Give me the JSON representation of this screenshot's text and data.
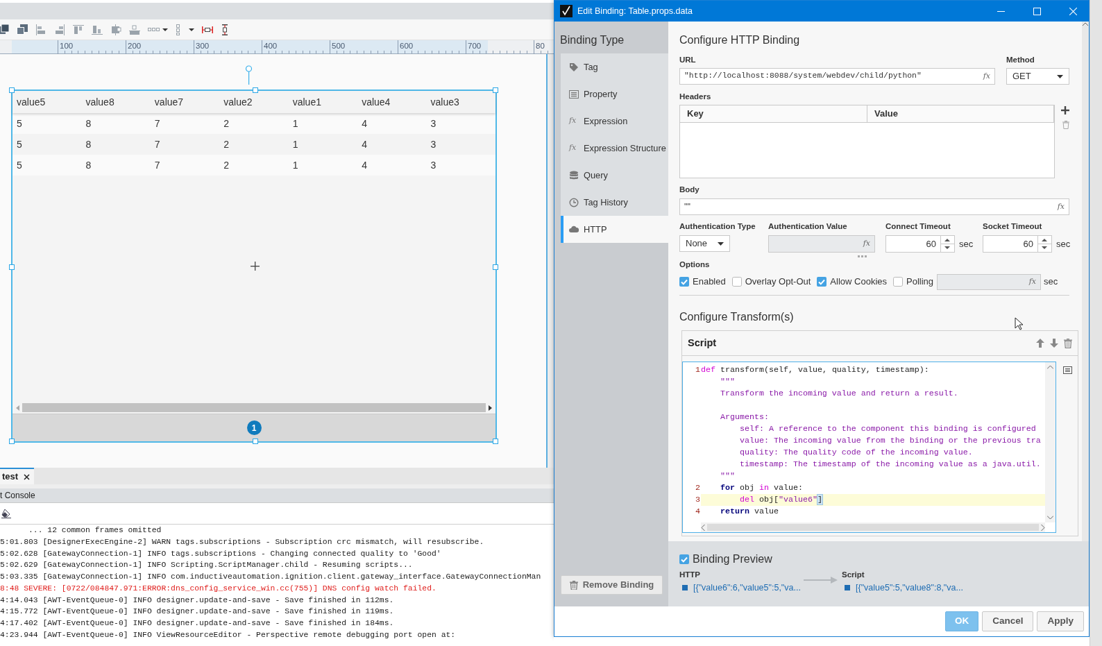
{
  "designer": {
    "ruler_labels": [
      "100",
      "200",
      "300",
      "400",
      "500",
      "600",
      "700",
      "80"
    ],
    "table": {
      "columns": [
        "value5",
        "value8",
        "value7",
        "value2",
        "value1",
        "value4",
        "value3"
      ],
      "rows": [
        [
          "5",
          "8",
          "7",
          "2",
          "1",
          "4",
          "3"
        ],
        [
          "5",
          "8",
          "7",
          "2",
          "1",
          "4",
          "3"
        ],
        [
          "5",
          "8",
          "7",
          "2",
          "1",
          "4",
          "3"
        ]
      ],
      "page": "1"
    },
    "tabs": [
      {
        "label": "test",
        "selected": true
      }
    ],
    "console": {
      "title": "t Console",
      "lines": [
        {
          "kind": "info",
          "text": "      ... 12 common frames omitted"
        },
        {
          "kind": "info",
          "text": "5:01.803 [DesignerExecEngine-2] WARN tags.subscriptions - Subscription crc mismatch, will resubscribe."
        },
        {
          "kind": "info",
          "text": "5:02.628 [GatewayConnection-1] INFO tags.subscriptions - Changing connected quality to 'Good'"
        },
        {
          "kind": "info",
          "text": "5:02.629 [GatewayConnection-1] INFO Scripting.ScriptManager.child - Resuming scripts..."
        },
        {
          "kind": "info",
          "text": "5:03.335 [GatewayConnection-1] INFO com.inductiveautomation.ignition.client.gateway_interface.GatewayConnectionMan"
        },
        {
          "kind": "severe",
          "text": "8:48 SEVERE: [0722/084847.971:ERROR:dns_config_service_win.cc(755)] DNS config watch failed."
        },
        {
          "kind": "info",
          "text": "4:14.043 [AWT-EventQueue-0] INFO designer.update-and-save - Save finished in 112ms."
        },
        {
          "kind": "info",
          "text": "4:15.772 [AWT-EventQueue-0] INFO designer.update-and-save - Save finished in 119ms."
        },
        {
          "kind": "info",
          "text": "4:17.402 [AWT-EventQueue-0] INFO designer.update-and-save - Save finished in 184ms."
        },
        {
          "kind": "info",
          "text": "4:23.944 [AWT-EventQueue-0] INFO ViewResourceEditor - Perspective remote debugging port open at:"
        }
      ]
    }
  },
  "dialog": {
    "title": "Edit Binding: Table.props.data",
    "sidebar": {
      "title": "Binding Type",
      "items": [
        {
          "kind": "tag",
          "label": "Tag",
          "selected": false
        },
        {
          "kind": "property",
          "label": "Property",
          "selected": false
        },
        {
          "kind": "expression",
          "glyph": "fx",
          "label": "Expression",
          "selected": false
        },
        {
          "kind": "expression",
          "glyph": "fx",
          "label": "Expression Structure",
          "selected": false
        },
        {
          "kind": "query",
          "label": "Query",
          "selected": false
        },
        {
          "kind": "history",
          "label": "Tag History",
          "selected": false
        },
        {
          "kind": "http",
          "label": "HTTP",
          "selected": true
        }
      ],
      "remove_button": "Remove Binding"
    },
    "heading": "Configure HTTP Binding",
    "url": {
      "label": "URL",
      "value": "\"http://localhost:8088/system/webdev/child/python\"",
      "fx": "fx"
    },
    "method": {
      "label": "Method",
      "value": "GET"
    },
    "headers": {
      "label": "Headers",
      "columns": [
        "Key",
        "Value"
      ]
    },
    "body": {
      "label": "Body",
      "value": "\"\"",
      "fx": "fx"
    },
    "auth_type": {
      "label": "Authentication Type",
      "value": "None"
    },
    "auth_value": {
      "label": "Authentication Value",
      "disabled": true,
      "fx": "fx"
    },
    "connect_timeout": {
      "label": "Connect Timeout",
      "value": "60",
      "unit": "sec"
    },
    "socket_timeout": {
      "label": "Socket Timeout",
      "value": "60",
      "unit": "sec"
    },
    "options": {
      "label": "Options",
      "items": [
        {
          "label": "Enabled",
          "checked": true
        },
        {
          "label": "Overlay Opt-Out",
          "checked": false
        },
        {
          "label": "Allow Cookies",
          "checked": true
        },
        {
          "label": "Polling",
          "checked": false
        }
      ],
      "polling_field": {
        "disabled": true,
        "fx": "fx",
        "unit": "sec"
      }
    },
    "transforms": {
      "heading": "Configure Transform(s)",
      "script": {
        "title": "Script",
        "lines": [
          {
            "number": "1",
            "current": false,
            "tokens": [
              {
                "kind": "keyword",
                "text": "def"
              },
              {
                "kind": "plain",
                "text": " transform(self, value, quality, timestamp):"
              }
            ]
          },
          {
            "current": false,
            "tokens": [
              {
                "kind": "string",
                "text": "    \"\"\""
              }
            ]
          },
          {
            "current": false,
            "tokens": [
              {
                "kind": "string",
                "text": "    Transform the incoming value and return a result."
              }
            ]
          },
          {
            "current": false
          },
          {
            "current": false,
            "tokens": [
              {
                "kind": "string",
                "text": "    Arguments:"
              }
            ]
          },
          {
            "current": false,
            "tokens": [
              {
                "kind": "string",
                "text": "        self: A reference to the component this binding is configured"
              }
            ]
          },
          {
            "current": false,
            "tokens": [
              {
                "kind": "string",
                "text": "        value: The incoming value from the binding or the previous tra"
              }
            ]
          },
          {
            "current": false,
            "tokens": [
              {
                "kind": "string",
                "text": "        quality: The quality code of the incoming value."
              }
            ]
          },
          {
            "current": false,
            "tokens": [
              {
                "kind": "string",
                "text": "        timestamp: The timestamp of the incoming value as a java.util."
              }
            ]
          },
          {
            "current": false,
            "tokens": [
              {
                "kind": "string",
                "text": "    \"\"\""
              }
            ]
          },
          {
            "number": "2",
            "current": false,
            "tokens": [
              {
                "kind": "control",
                "text": "    for"
              },
              {
                "kind": "plain",
                "text": " obj "
              },
              {
                "kind": "keyword",
                "text": "in"
              },
              {
                "kind": "plain",
                "text": " value:"
              }
            ]
          },
          {
            "number": "3",
            "current": true,
            "tokens": [
              {
                "kind": "keyword",
                "text": "        del"
              },
              {
                "kind": "plain",
                "text": " obj["
              },
              {
                "kind": "string",
                "text": "\"value6\""
              },
              {
                "kind": "match",
                "text": "]"
              }
            ]
          },
          {
            "number": "4",
            "current": false,
            "tokens": [
              {
                "kind": "control",
                "text": "    return"
              },
              {
                "kind": "plain",
                "text": " value"
              }
            ]
          }
        ]
      }
    },
    "preview": {
      "label": "Binding Preview",
      "checked": true,
      "stages": [
        {
          "label": "HTTP",
          "value": "[{\"value6\":6,\"value5\":5,\"va..."
        },
        {
          "label": "Script",
          "value": "[{\"value5\":5,\"value8\":8,\"va..."
        }
      ]
    },
    "buttons": [
      {
        "label": "OK",
        "kind": "primary"
      },
      {
        "label": "Cancel",
        "kind": "default"
      },
      {
        "label": "Apply",
        "kind": "default"
      }
    ]
  }
}
